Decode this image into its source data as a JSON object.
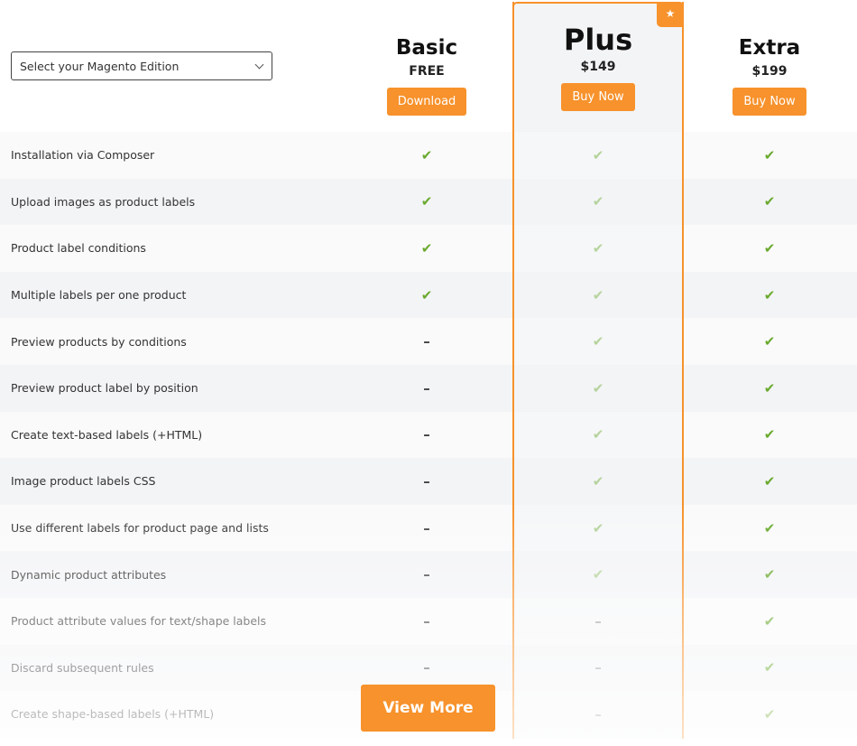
{
  "edition_select": {
    "label": "Select your Magento Edition",
    "icon": "chevron-down-icon"
  },
  "plans": {
    "basic": {
      "name": "Basic",
      "price": "FREE",
      "button": "Download"
    },
    "plus": {
      "name": "Plus",
      "price": "$149",
      "button": "Buy Now",
      "badge_icon": "★",
      "featured": true
    },
    "extra": {
      "name": "Extra",
      "price": "$199",
      "button": "Buy Now"
    }
  },
  "colors": {
    "accent": "#f7922c",
    "check": "#6aaa2e"
  },
  "features": [
    {
      "name": "Installation via Composer",
      "basic": "✔",
      "plus": "✔",
      "extra": "✔"
    },
    {
      "name": "Upload images as product labels",
      "basic": "✔",
      "plus": "✔",
      "extra": "✔"
    },
    {
      "name": "Product label conditions",
      "basic": "✔",
      "plus": "✔",
      "extra": "✔"
    },
    {
      "name": "Multiple labels per one product",
      "basic": "✔",
      "plus": "✔",
      "extra": "✔"
    },
    {
      "name": "Preview products by conditions",
      "basic": "–",
      "plus": "✔",
      "extra": "✔"
    },
    {
      "name": "Preview product label by position",
      "basic": "–",
      "plus": "✔",
      "extra": "✔"
    },
    {
      "name": "Create text-based labels (+HTML)",
      "basic": "–",
      "plus": "✔",
      "extra": "✔"
    },
    {
      "name": "Image product labels CSS",
      "basic": "–",
      "plus": "✔",
      "extra": "✔"
    },
    {
      "name": "Use different labels for product page and lists",
      "basic": "–",
      "plus": "✔",
      "extra": "✔"
    },
    {
      "name": "Dynamic product attributes",
      "basic": "–",
      "plus": "✔",
      "extra": "✔"
    },
    {
      "name": "Product attribute values for text/shape labels",
      "basic": "–",
      "plus": "–",
      "extra": "✔"
    },
    {
      "name": "Discard subsequent rules",
      "basic": "–",
      "plus": "–",
      "extra": "✔"
    },
    {
      "name": "Create shape-based labels (+HTML)",
      "basic": "–",
      "plus": "–",
      "extra": "✔"
    }
  ],
  "view_more": "View More"
}
